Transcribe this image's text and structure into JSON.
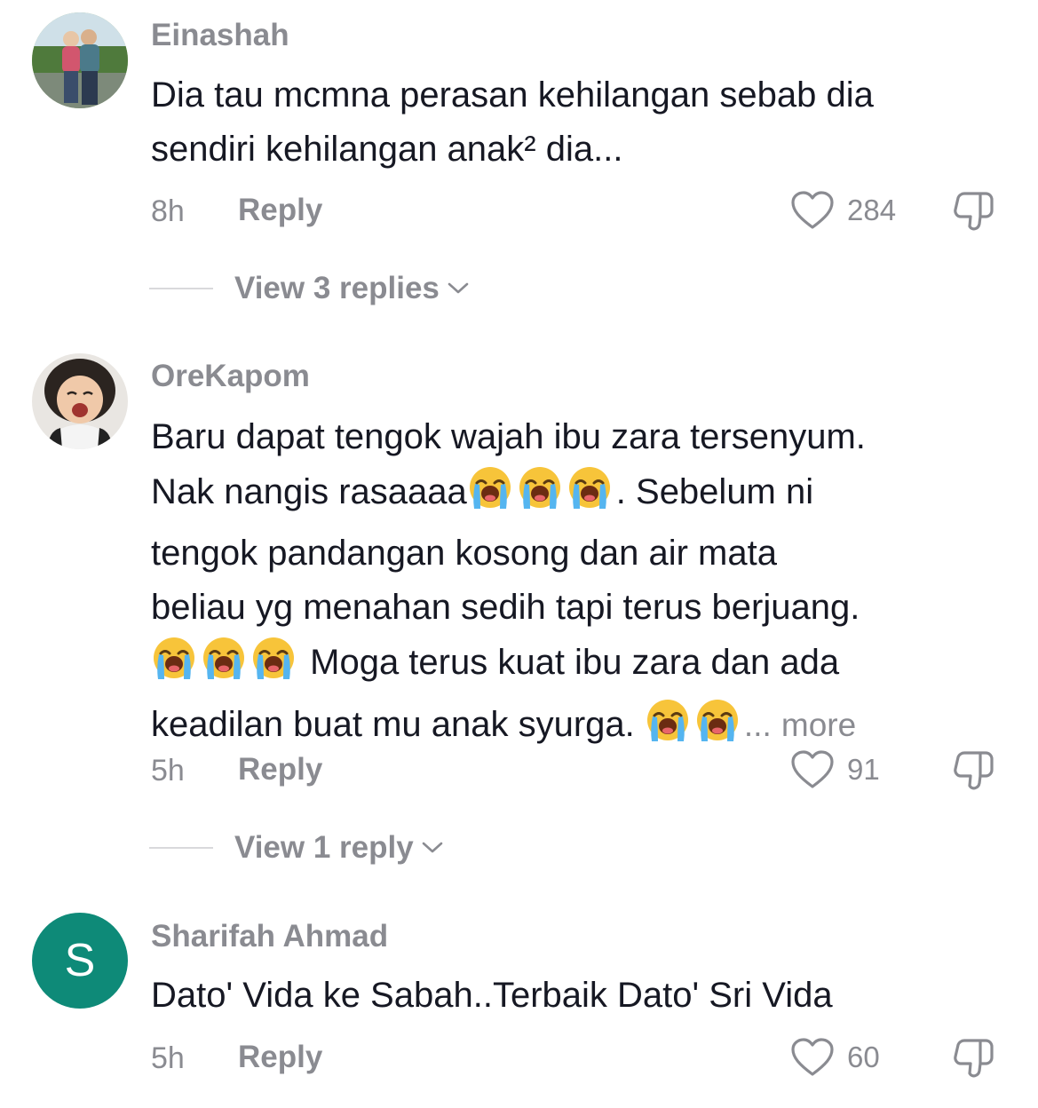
{
  "comments": [
    {
      "username": "Einashah",
      "lines": [
        "Dia tau mcmna perasan kehilangan sebab dia",
        "sendiri kehilangan anak² dia..."
      ],
      "time": "8h",
      "reply_label": "Reply",
      "likes": "284",
      "view_replies": "View 3 replies",
      "avatar": "photo-couple-outdoors"
    },
    {
      "username": "OreKapom",
      "line1": "Baru dapat tengok wajah ibu zara tersenyum.",
      "line2_text": "Nak nangis rasaaaa",
      "line2_tail": ". Sebelum ni",
      "line3": "tengok pandangan kosong dan air mata",
      "line4": "beliau yg menahan sedih tapi terus berjuang.",
      "line5_tail": "Moga terus kuat ibu zara dan ada",
      "line6_text": "keadilan buat mu anak syurga.",
      "line6_ellipsis": "...",
      "more_label": "more",
      "time": "5h",
      "reply_label": "Reply",
      "likes": "91",
      "view_replies": "View 1 reply",
      "avatar": "photo-crying-child",
      "emoji": "loudly-crying-face"
    },
    {
      "username": "Sharifah Ahmad",
      "lines": [
        "Dato' Vida ke Sabah..Terbaik Dato' Sri Vida"
      ],
      "time": "5h",
      "reply_label": "Reply",
      "likes": "60",
      "avatar_letter": "S",
      "avatar_color": "#0e8a78"
    }
  ]
}
